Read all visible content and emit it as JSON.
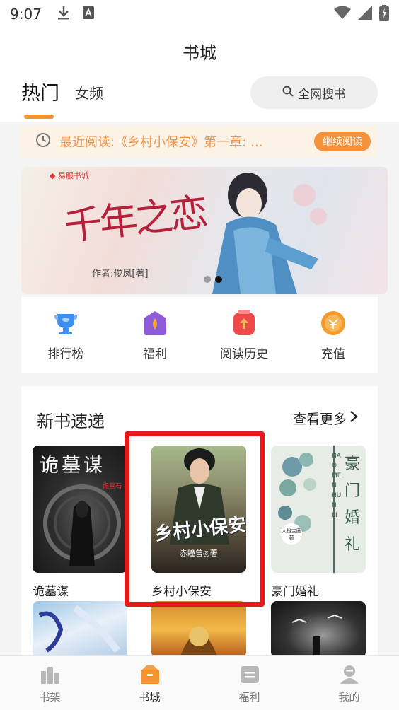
{
  "status_bar": {
    "time": "9:07"
  },
  "header": {
    "title": "书城"
  },
  "tabs": {
    "hot": "热门",
    "female": "女频"
  },
  "search": {
    "label": "全网搜书"
  },
  "recent": {
    "text": "最近阅读:《乡村小保安》第一章: …",
    "button": "继续阅读"
  },
  "banner": {
    "tag": "◆ 易服书城",
    "title_art": "千年之恋",
    "author": "作者:俊凤[著]",
    "slide_count": 2,
    "active_slide": 2
  },
  "quick_menu": [
    {
      "label": "排行榜",
      "icon": "trophy-icon",
      "color": "#3f8ff0"
    },
    {
      "label": "福利",
      "icon": "gift-icon",
      "color": "#8e5bd9"
    },
    {
      "label": "阅读历史",
      "icon": "history-icon",
      "color": "#ee4a4a"
    },
    {
      "label": "充值",
      "icon": "coin-icon",
      "color": "#f59a2e"
    }
  ],
  "new_books": {
    "title": "新书速递",
    "more": "查看更多",
    "books": [
      {
        "title": "诡墓谋",
        "cover_text": "诡墓谋",
        "cover_author": "诡墓石"
      },
      {
        "title": "乡村小保安",
        "cover_text": "乡村小保安",
        "cover_author": "赤瞳兽◎著"
      },
      {
        "title": "豪门婚礼",
        "cover_text": "豪门婚礼",
        "cover_pinyin": "HAO MEN HUN LI",
        "cover_author": "大橙宝圈著"
      }
    ]
  },
  "bottom_nav": [
    {
      "label": "书架",
      "icon": "bookshelf-icon",
      "active": false
    },
    {
      "label": "书城",
      "icon": "bookstore-icon",
      "active": true
    },
    {
      "label": "福利",
      "icon": "welfare-icon",
      "active": false
    },
    {
      "label": "我的",
      "icon": "profile-icon",
      "active": false
    }
  ],
  "colors": {
    "accent": "#f7932f",
    "highlight": "#e3191c"
  }
}
